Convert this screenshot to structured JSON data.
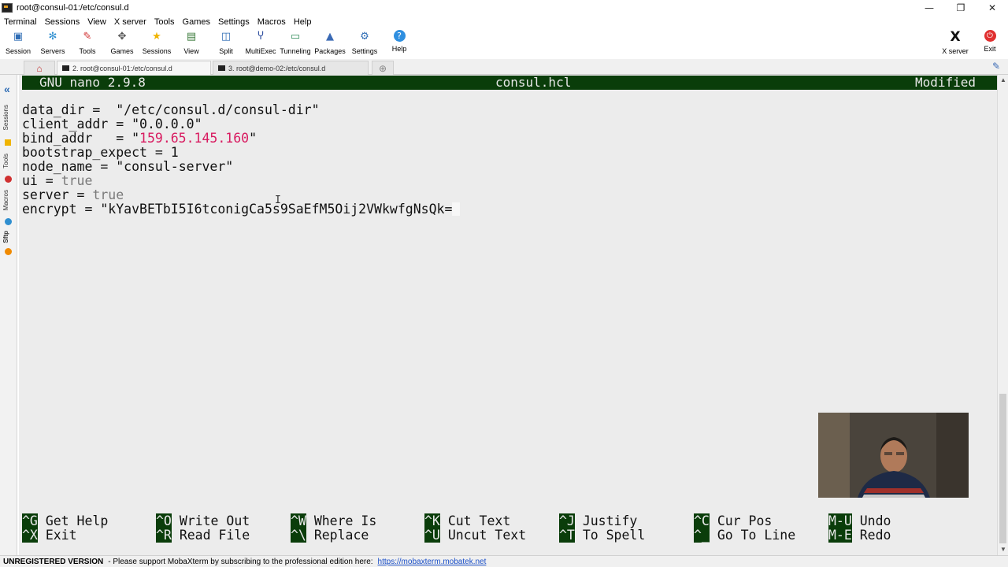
{
  "window": {
    "title": "root@consul-01:/etc/consul.d",
    "minimize": "—",
    "restore": "❐",
    "close": "✕"
  },
  "menu": [
    "Terminal",
    "Sessions",
    "View",
    "X server",
    "Tools",
    "Games",
    "Settings",
    "Macros",
    "Help"
  ],
  "toolbar": {
    "items": [
      {
        "label": "Session",
        "icon": "session-icon"
      },
      {
        "label": "Servers",
        "icon": "servers-icon"
      },
      {
        "label": "Tools",
        "icon": "tools-icon"
      },
      {
        "label": "Games",
        "icon": "games-icon"
      },
      {
        "label": "Sessions",
        "icon": "sessions-star-icon"
      },
      {
        "label": "View",
        "icon": "view-icon"
      },
      {
        "label": "Split",
        "icon": "split-icon"
      },
      {
        "label": "MultiExec",
        "icon": "multiexec-icon"
      },
      {
        "label": "Tunneling",
        "icon": "tunneling-icon"
      },
      {
        "label": "Packages",
        "icon": "packages-icon"
      },
      {
        "label": "Settings",
        "icon": "settings-gear-icon"
      },
      {
        "label": "Help",
        "icon": "help-icon"
      }
    ],
    "xserver_label": "X server",
    "exit_label": "Exit"
  },
  "tabs": [
    {
      "label": "2. root@consul-01:/etc/consul.d",
      "active": true
    },
    {
      "label": "3. root@demo-02:/etc/consul.d",
      "active": false
    }
  ],
  "sidepanel": {
    "labels": [
      "Sessions",
      "Tools",
      "Macros",
      "Sftp"
    ]
  },
  "nano": {
    "version": "GNU nano 2.9.8",
    "filename": "consul.hcl",
    "status": "Modified",
    "lines": [
      {
        "key": "data_dir",
        "sep": " =  ",
        "value": "\"/etc/consul.d/consul-dir\""
      },
      {
        "key": "client_addr",
        "sep": " = ",
        "value": "\"0.0.0.0\""
      },
      {
        "key": "bind_addr",
        "sep": "   = ",
        "q1": "\"",
        "value": "159.65.145.160",
        "q2": "\""
      },
      {
        "key": "bootstrap_expect",
        "sep": " = ",
        "value": "1"
      },
      {
        "key": "node_name",
        "sep": " = ",
        "value": "\"consul-server\""
      },
      {
        "key": "ui",
        "sep": " = ",
        "value": "true"
      },
      {
        "key": "server",
        "sep": " = ",
        "value": "true"
      },
      {
        "key": "encrypt",
        "sep": " = ",
        "value": "\"kYavBETbI5I6tconigCa5s9SaEfM5Oij2VWkwfgNsQk="
      }
    ],
    "shortcuts": [
      [
        {
          "key": "^G",
          "label": "Get Help"
        },
        {
          "key": "^X",
          "label": "Exit"
        }
      ],
      [
        {
          "key": "^O",
          "label": "Write Out"
        },
        {
          "key": "^R",
          "label": "Read File"
        }
      ],
      [
        {
          "key": "^W",
          "label": "Where Is"
        },
        {
          "key": "^\\",
          "label": "Replace"
        }
      ],
      [
        {
          "key": "^K",
          "label": "Cut Text"
        },
        {
          "key": "^U",
          "label": "Uncut Text"
        }
      ],
      [
        {
          "key": "^J",
          "label": "Justify"
        },
        {
          "key": "^T",
          "label": "To Spell"
        }
      ],
      [
        {
          "key": "^C",
          "label": "Cur Pos"
        },
        {
          "key": "^_",
          "label": "Go To Line"
        }
      ],
      [
        {
          "key": "M-U",
          "label": "Undo"
        },
        {
          "key": "M-E",
          "label": "Redo"
        }
      ]
    ]
  },
  "statusbar": {
    "version": "UNREGISTERED VERSION",
    "message": "-  Please support MobaXterm by subscribing to the professional edition here:",
    "link": "https://mobaxterm.mobatek.net"
  },
  "colors": {
    "nano_bar": "#0a3d0a",
    "terminal_bg": "#ececec",
    "string_pink": "#d81b60",
    "keyword_gray": "#7a7a7a"
  }
}
